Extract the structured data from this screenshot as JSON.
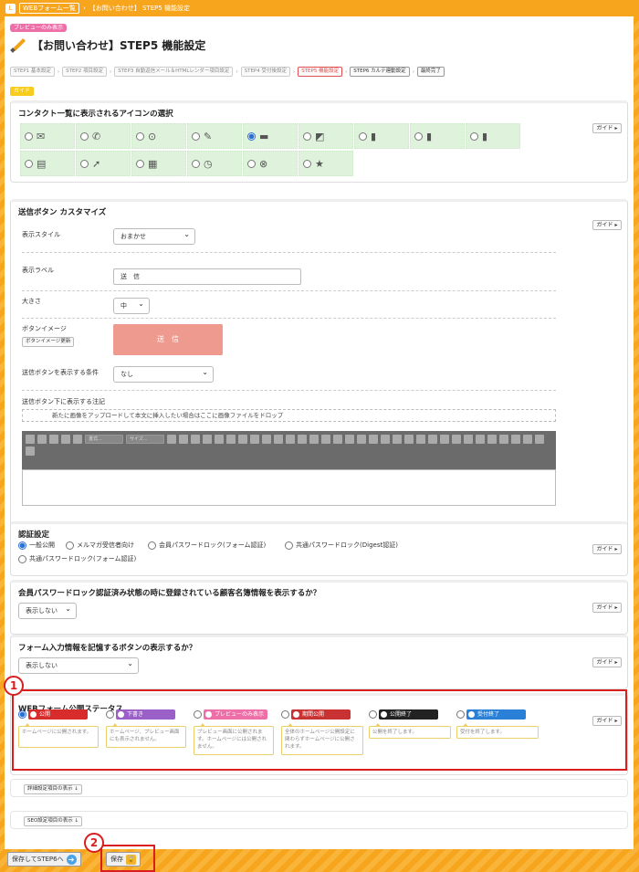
{
  "topbar": {
    "home": "L",
    "crumb1": "WEBフォーム一覧",
    "crumb2": "【お問い合わせ】 STEP5 機能設定"
  },
  "preview_badge": "プレビューのみ表示",
  "title": "【お問い合わせ】STEP5 機能設定",
  "steps": [
    "STEP1 基本設定",
    "STEP2 項目設定",
    "STEP3 自動返信メール＆HTMLレンダー項目設定",
    "STEP4 受付後設定",
    "STEP5 機能設定",
    "STEP6 カルテ連動設定",
    "最終完了"
  ],
  "guide_badge": "ガイド",
  "guide_label": "ガイド ▸",
  "icon_section": {
    "title": "コンタクト一覧に表示されるアイコンの選択",
    "icons": [
      "✉",
      "✆",
      "⊙",
      "✎",
      "▬",
      "◩",
      "▮",
      "▮",
      "▮",
      "▤",
      "➚",
      "▦",
      "◷",
      "⊗",
      "★"
    ],
    "selected_index": 4
  },
  "send_section": {
    "title": "送信ボタン カスタマイズ",
    "style_label": "表示スタイル",
    "style_value": "おまかせ",
    "display_label": "表示ラベル",
    "display_value": "送　信",
    "size_label": "大きさ",
    "size_value": "中",
    "image_label": "ボタンイメージ",
    "image_btn": "ボタンイメージ更新",
    "preview": "送　信",
    "condition_label": "送信ボタンを表示する条件",
    "condition_value": "なし",
    "note_label": "送信ボタン下に表示する注記",
    "drop_text": "新たに画像をアップロードして本文に挿入したい場合はここに画像ファイルをドロップ",
    "font_select": "書式...",
    "size_select": "サイズ..."
  },
  "auth_section": {
    "title": "認証設定",
    "options": [
      "一般公開",
      "メルマガ受信者向け",
      "会員パスワードロック(フォーム認証)",
      "共通パスワードロック(Digest認証)",
      "共通パスワードロック(フォーム認証)"
    ],
    "selected_index": 0
  },
  "member_section": {
    "title": "会員パスワードロック認証済み状態の時に登録されている顧客名簿情報を表示するか？",
    "value": "表示しない"
  },
  "remember_section": {
    "title": "フォーム入力情報を記憶するボタンの表示するか？",
    "value": "表示しない"
  },
  "status_section": {
    "title": "WEBフォーム公開ステータス",
    "options": [
      {
        "label": "公開",
        "color": "#d82b2b",
        "tip": "ホームページに公開されます。"
      },
      {
        "label": "下書き",
        "color": "#9b5fc8",
        "tip": "ホームページ、プレビュー画面にも表示されません。"
      },
      {
        "label": "プレビューのみ表示",
        "color": "#ee6fa8",
        "tip": "プレビュー画面に公開されます。ホームページには公開されません。"
      },
      {
        "label": "期間公開",
        "color": "#c83232",
        "tip": "全体のホームページ公開設定に関わらずホームページに公開されます。"
      },
      {
        "label": "公開終了",
        "color": "#222222",
        "tip": "公開を終了します。"
      },
      {
        "label": "受付終了",
        "color": "#2a7fd6",
        "tip": "受付を終了します。"
      }
    ],
    "selected_index": 0
  },
  "detail_toggle": "詳細設定項目の表示 ↓",
  "seo_toggle": "SEO設定項目の表示 ↓",
  "footer": {
    "save_next": "保存してSTEP6へ",
    "save": "保存"
  },
  "annotations": {
    "one": "1",
    "two": "2"
  }
}
